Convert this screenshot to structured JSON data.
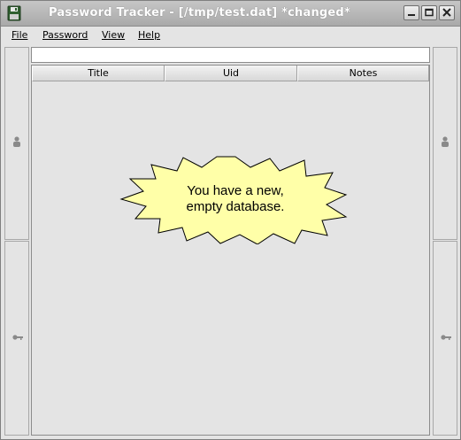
{
  "window": {
    "title": "Password Tracker - [/tmp/test.dat] *changed*"
  },
  "menu": {
    "items": [
      {
        "label": "File"
      },
      {
        "label": "Password"
      },
      {
        "label": "View"
      },
      {
        "label": "Help"
      }
    ]
  },
  "search": {
    "value": ""
  },
  "table": {
    "columns": [
      "Title",
      "Uid",
      "Notes"
    ]
  },
  "empty_state": {
    "line1": "You have a new,",
    "line2": "empty database."
  },
  "colors": {
    "starburst_fill": "#ffffa8",
    "title_text": "#ffffff"
  },
  "icons": {
    "app": "floppy-disk-icon",
    "left_top": "person-icon",
    "left_bottom": "key-icon",
    "right_top": "person-icon",
    "right_bottom": "key-icon"
  }
}
